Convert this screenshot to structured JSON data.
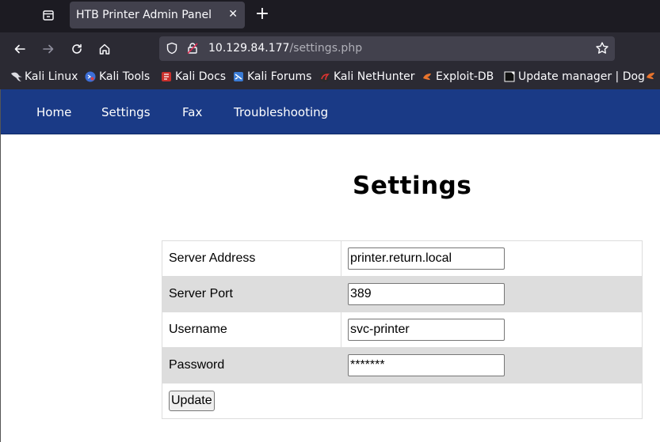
{
  "browser": {
    "tab_title": "HTB Printer Admin Panel",
    "tab_close": "✕",
    "new_tab": "+",
    "url_host": "10.129.84.177",
    "url_path": "/settings.php"
  },
  "bookmarks": [
    {
      "label": "Kali Linux",
      "icon": "kali-dragon-icon"
    },
    {
      "label": "Kali Tools",
      "icon": "kali-tools-icon"
    },
    {
      "label": "Kali Docs",
      "icon": "kali-docs-icon"
    },
    {
      "label": "Kali Forums",
      "icon": "kali-forums-icon"
    },
    {
      "label": "Kali NetHunter",
      "icon": "kali-nethunter-icon"
    },
    {
      "label": "Exploit-DB",
      "icon": "exploit-db-icon"
    },
    {
      "label": "Update manager | Dog",
      "icon": "update-manager-icon"
    }
  ],
  "site_nav": {
    "home": "Home",
    "settings": "Settings",
    "fax": "Fax",
    "troubleshooting": "Troubleshooting"
  },
  "page": {
    "title": "Settings",
    "fields": {
      "server_address": {
        "label": "Server Address",
        "value": "printer.return.local"
      },
      "server_port": {
        "label": "Server Port",
        "value": "389"
      },
      "username": {
        "label": "Username",
        "value": "svc-printer"
      },
      "password": {
        "label": "Password",
        "value": "*******"
      }
    },
    "update_label": "Update"
  },
  "colors": {
    "nav_bg": "#1a3a86",
    "browser_bg": "#2b2a33",
    "tabbar_bg": "#1c1b22"
  }
}
